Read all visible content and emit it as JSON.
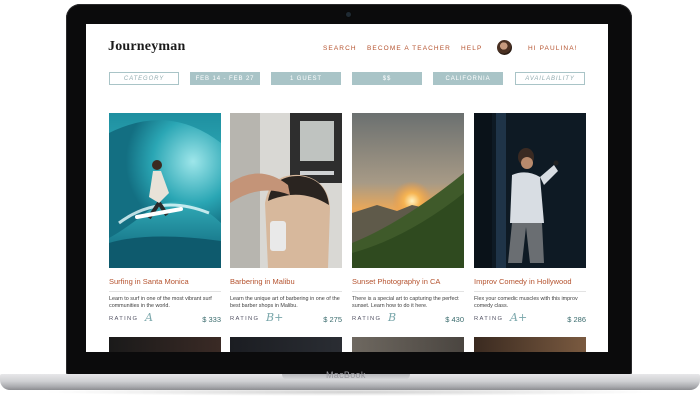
{
  "device": {
    "brand": "MacBook"
  },
  "site": {
    "logo": "Journeyman",
    "nav": [
      "SEARCH",
      "BECOME A TEACHER",
      "HELP",
      "HI PAULINA!"
    ]
  },
  "filters": [
    {
      "label": "CATEGORY",
      "style": "outline"
    },
    {
      "label": "FEB 14 - FEB 27",
      "style": "filled"
    },
    {
      "label": "1 GUEST",
      "style": "filled"
    },
    {
      "label": "$$",
      "style": "filled"
    },
    {
      "label": "CALIFORNIA",
      "style": "filled"
    },
    {
      "label": "AVAILABILITY",
      "style": "outline"
    }
  ],
  "cards": [
    {
      "title": "Surfing in Santa Monica",
      "description": "Learn to surf in one of the most vibrant surf communities in the world.",
      "rating_label": "RATING",
      "rating_glyph": "A",
      "price": "$ 333"
    },
    {
      "title": "Barbering in Malibu",
      "description": "Learn the unique art of barbering in one of the best barber shops in Malibu.",
      "rating_label": "RATING",
      "rating_glyph": "B+",
      "price": "$ 275"
    },
    {
      "title": "Sunset Photography in CA",
      "description": "There is a special art to capturing the perfect sunset. Learn how to do it here.",
      "rating_label": "RATING",
      "rating_glyph": "B",
      "price": "$ 430"
    },
    {
      "title": "Improv Comedy in Hollywood",
      "description": "Flex your comedic muscles with this improv comedy class.",
      "rating_label": "RATING",
      "rating_glyph": "A+",
      "price": "$ 286"
    }
  ],
  "colors": {
    "accent": "#b5532f",
    "teal": "#a9c4c7",
    "price": "#3a6b6d"
  }
}
